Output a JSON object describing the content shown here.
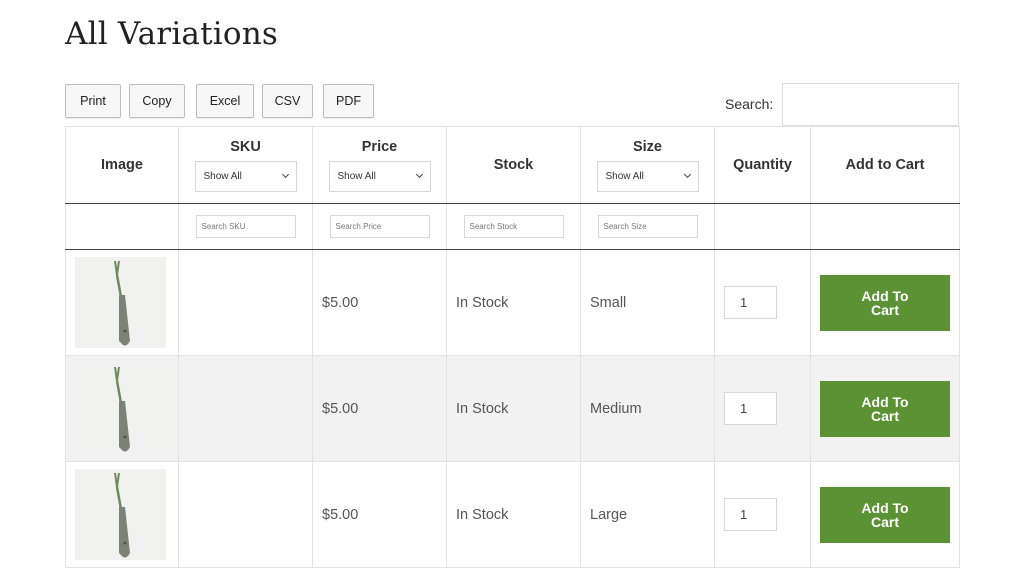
{
  "page": {
    "title": "All Variations"
  },
  "toolbar": {
    "buttons": [
      {
        "label": "Print"
      },
      {
        "label": "Copy"
      },
      {
        "label": "Excel"
      },
      {
        "label": "CSV"
      },
      {
        "label": "PDF"
      }
    ],
    "search_label": "Search:",
    "search_value": ""
  },
  "table": {
    "columns": {
      "image": "Image",
      "sku": "SKU",
      "price": "Price",
      "stock": "Stock",
      "size": "Size",
      "quantity": "Quantity",
      "add_to_cart": "Add to Cart"
    },
    "selects": {
      "sku": "Show All",
      "price": "Show All",
      "size": "Show All"
    },
    "filters": {
      "sku": "Search SKU",
      "price": "Search Price",
      "stock": "Search Stock",
      "size": "Search Size"
    },
    "rows": [
      {
        "sku": "",
        "price": "$5.00",
        "stock": "In Stock",
        "size": "Small",
        "qty": "1",
        "button": "Add To Cart"
      },
      {
        "sku": "",
        "price": "$5.00",
        "stock": "In Stock",
        "size": "Medium",
        "qty": "1",
        "button": "Add To Cart"
      },
      {
        "sku": "",
        "price": "$5.00",
        "stock": "In Stock",
        "size": "Large",
        "qty": "1",
        "button": "Add To Cart"
      }
    ]
  },
  "colors": {
    "cart_button": "#5b9233",
    "row_alt": "#f2f2f2"
  }
}
